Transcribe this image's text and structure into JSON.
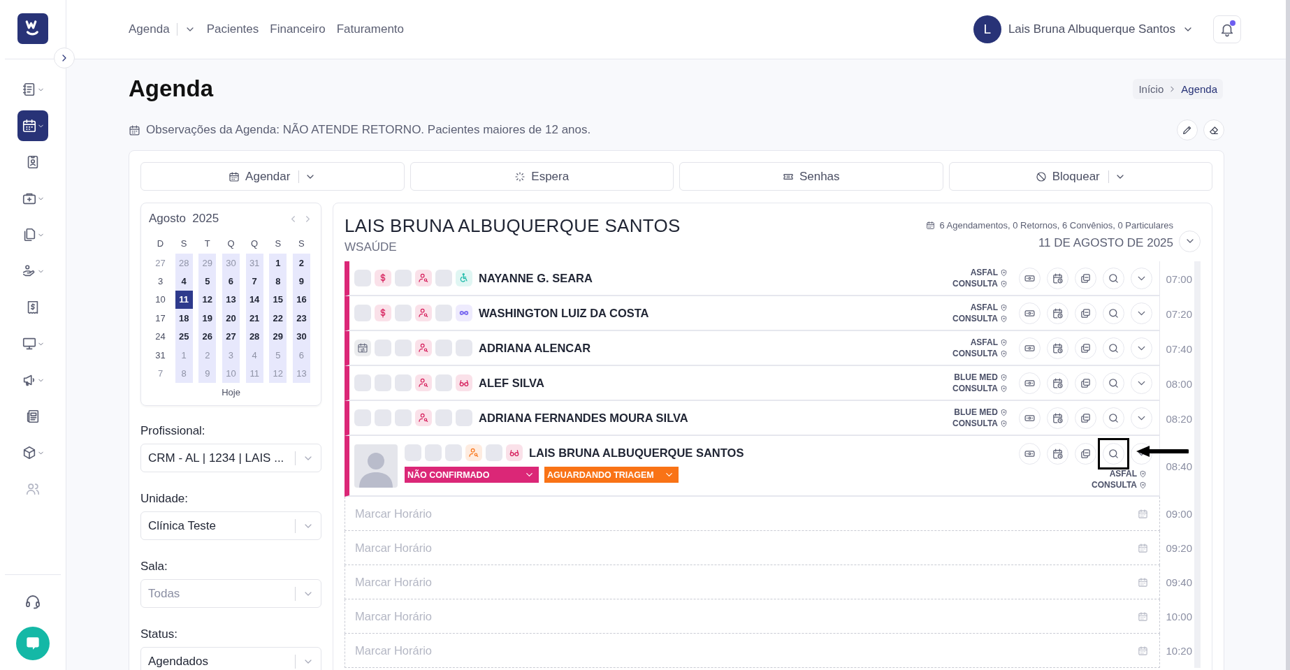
{
  "sidebar": {
    "items": [
      {
        "kind": "notebook",
        "has_menu": true,
        "selected": false,
        "disabled": false
      },
      {
        "kind": "calendar",
        "has_menu": true,
        "selected": true,
        "disabled": false
      },
      {
        "kind": "id-card",
        "has_menu": false,
        "selected": false,
        "disabled": false
      },
      {
        "kind": "medkit",
        "has_menu": true,
        "selected": false,
        "disabled": false
      },
      {
        "kind": "files",
        "has_menu": true,
        "selected": false,
        "disabled": false
      },
      {
        "kind": "hand",
        "has_menu": true,
        "selected": false,
        "disabled": false
      },
      {
        "kind": "receipt",
        "has_menu": false,
        "selected": false,
        "disabled": false
      },
      {
        "kind": "monitor",
        "has_menu": true,
        "selected": false,
        "disabled": false
      },
      {
        "kind": "megaphone",
        "has_menu": true,
        "selected": false,
        "disabled": false
      },
      {
        "kind": "news",
        "has_menu": false,
        "selected": false,
        "disabled": false
      },
      {
        "kind": "box",
        "has_menu": true,
        "selected": false,
        "disabled": false
      },
      {
        "kind": "users",
        "has_menu": false,
        "selected": false,
        "disabled": true
      }
    ]
  },
  "top_nav": {
    "links": [
      {
        "label": "Agenda",
        "has_menu": true
      },
      {
        "label": "Pacientes",
        "has_menu": false
      },
      {
        "label": "Financeiro",
        "has_menu": false
      },
      {
        "label": "Faturamento",
        "has_menu": false
      }
    ]
  },
  "user": {
    "initial": "L",
    "name": "Lais Bruna Albuquerque Santos"
  },
  "notifications": {
    "unread": true
  },
  "page": {
    "title": "Agenda",
    "breadcrumb": [
      {
        "label": "Início",
        "current": false
      },
      {
        "label": "Agenda",
        "current": true
      }
    ],
    "notes": "Observações da Agenda: NÃO ATENDE RETORNO. Pacientes maiores de 12 anos."
  },
  "actions": [
    {
      "label": "Agendar",
      "kind": "calendar",
      "has_menu": true
    },
    {
      "label": "Espera",
      "kind": "loader",
      "has_menu": false
    },
    {
      "label": "Senhas",
      "kind": "ticket",
      "has_menu": false
    },
    {
      "label": "Bloquear",
      "kind": "ban",
      "has_menu": true
    }
  ],
  "calendar": {
    "month": "Agosto",
    "year": "2025",
    "today_label": "Hoje",
    "weekdays": [
      {
        "label": "D",
        "open": false
      },
      {
        "label": "S",
        "open": true
      },
      {
        "label": "T",
        "open": true
      },
      {
        "label": "Q",
        "open": true
      },
      {
        "label": "Q",
        "open": true
      },
      {
        "label": "S",
        "open": true
      },
      {
        "label": "S",
        "open": true
      }
    ],
    "days": [
      {
        "label": "27",
        "muted": true,
        "selected": false
      },
      {
        "label": "28",
        "muted": true,
        "selected": false
      },
      {
        "label": "29",
        "muted": true,
        "selected": false
      },
      {
        "label": "30",
        "muted": true,
        "selected": false
      },
      {
        "label": "31",
        "muted": true,
        "selected": false
      },
      {
        "label": "1",
        "muted": false,
        "selected": false
      },
      {
        "label": "2",
        "muted": false,
        "selected": false
      },
      {
        "label": "3",
        "muted": false,
        "selected": false
      },
      {
        "label": "4",
        "muted": false,
        "selected": false
      },
      {
        "label": "5",
        "muted": false,
        "selected": false
      },
      {
        "label": "6",
        "muted": false,
        "selected": false
      },
      {
        "label": "7",
        "muted": false,
        "selected": false
      },
      {
        "label": "8",
        "muted": false,
        "selected": false
      },
      {
        "label": "9",
        "muted": false,
        "selected": false
      },
      {
        "label": "10",
        "muted": false,
        "selected": false
      },
      {
        "label": "11",
        "muted": false,
        "selected": true
      },
      {
        "label": "12",
        "muted": false,
        "selected": false
      },
      {
        "label": "13",
        "muted": false,
        "selected": false
      },
      {
        "label": "14",
        "muted": false,
        "selected": false
      },
      {
        "label": "15",
        "muted": false,
        "selected": false
      },
      {
        "label": "16",
        "muted": false,
        "selected": false
      },
      {
        "label": "17",
        "muted": false,
        "selected": false
      },
      {
        "label": "18",
        "muted": false,
        "selected": false
      },
      {
        "label": "19",
        "muted": false,
        "selected": false
      },
      {
        "label": "20",
        "muted": false,
        "selected": false
      },
      {
        "label": "21",
        "muted": false,
        "selected": false
      },
      {
        "label": "22",
        "muted": false,
        "selected": false
      },
      {
        "label": "23",
        "muted": false,
        "selected": false
      },
      {
        "label": "24",
        "muted": false,
        "selected": false
      },
      {
        "label": "25",
        "muted": false,
        "selected": false
      },
      {
        "label": "26",
        "muted": false,
        "selected": false
      },
      {
        "label": "27",
        "muted": false,
        "selected": false
      },
      {
        "label": "28",
        "muted": false,
        "selected": false
      },
      {
        "label": "29",
        "muted": false,
        "selected": false
      },
      {
        "label": "30",
        "muted": false,
        "selected": false
      },
      {
        "label": "31",
        "muted": false,
        "selected": false
      },
      {
        "label": "1",
        "muted": true,
        "selected": false
      },
      {
        "label": "2",
        "muted": true,
        "selected": false
      },
      {
        "label": "3",
        "muted": true,
        "selected": false
      },
      {
        "label": "4",
        "muted": true,
        "selected": false
      },
      {
        "label": "5",
        "muted": true,
        "selected": false
      },
      {
        "label": "6",
        "muted": true,
        "selected": false
      },
      {
        "label": "7",
        "muted": true,
        "selected": false
      },
      {
        "label": "8",
        "muted": true,
        "selected": false
      },
      {
        "label": "9",
        "muted": true,
        "selected": false
      },
      {
        "label": "10",
        "muted": true,
        "selected": false
      },
      {
        "label": "11",
        "muted": true,
        "selected": false
      },
      {
        "label": "12",
        "muted": true,
        "selected": false
      },
      {
        "label": "13",
        "muted": true,
        "selected": false
      }
    ]
  },
  "filters": [
    {
      "label": "Profissional:",
      "value": "CRM - AL | 1234 | LAIS ..."
    },
    {
      "label": "Unidade:",
      "value": "Clínica Teste"
    },
    {
      "label": "Sala:",
      "placeholder": "Todas"
    },
    {
      "label": "Status:",
      "value": "Agendados"
    }
  ],
  "schedule": {
    "professional": "LAIS BRUNA ALBUQUERQUE SANTOS",
    "clinic": "WSAÚDE",
    "summary": "6 Agendamentos, 0 Retornos, 6 Convênios, 0 Particulares",
    "date": "11 DE AGOSTO DE 2025",
    "rows": [
      {
        "kind": "appointment",
        "name": "NAYANNE G. SEARA",
        "insurer": "ASFAL",
        "procedure": "CONSULTA",
        "time": "07:00",
        "expanded": false,
        "search_highlighted": false,
        "badges": [
          {
            "kind": "blank"
          },
          {
            "kind": "dollar",
            "color": "#d61f5c"
          },
          {
            "kind": "blank"
          },
          {
            "kind": "person",
            "color": "#d61f5c"
          },
          {
            "kind": "blank"
          },
          {
            "kind": "accessible",
            "color": "#14b8a6"
          }
        ]
      },
      {
        "kind": "appointment",
        "name": "WASHINGTON LUIZ DA COSTA",
        "insurer": "ASFAL",
        "procedure": "CONSULTA",
        "time": "07:20",
        "expanded": false,
        "search_highlighted": false,
        "badges": [
          {
            "kind": "blank"
          },
          {
            "kind": "dollar",
            "color": "#d61f5c"
          },
          {
            "kind": "blank"
          },
          {
            "kind": "person",
            "color": "#d61f5c"
          },
          {
            "kind": "blank"
          },
          {
            "kind": "infinity",
            "color": "#7c6cf0"
          }
        ]
      },
      {
        "kind": "appointment",
        "name": "ADRIANA ALENCAR",
        "insurer": "ASFAL",
        "procedure": "CONSULTA",
        "time": "07:40",
        "expanded": false,
        "search_highlighted": false,
        "badges": [
          {
            "kind": "calendar-sync",
            "color": "#6b6f82"
          },
          {
            "kind": "blank"
          },
          {
            "kind": "blank"
          },
          {
            "kind": "person",
            "color": "#d61f5c"
          },
          {
            "kind": "blank"
          },
          {
            "kind": "blank"
          }
        ]
      },
      {
        "kind": "appointment",
        "name": "ALEF SILVA",
        "insurer": "BLUE MED",
        "procedure": "CONSULTA",
        "time": "08:00",
        "expanded": false,
        "search_highlighted": false,
        "badges": [
          {
            "kind": "blank"
          },
          {
            "kind": "blank"
          },
          {
            "kind": "blank"
          },
          {
            "kind": "person",
            "color": "#d61f5c"
          },
          {
            "kind": "blank"
          },
          {
            "kind": "glasses",
            "color": "#d61f5c"
          }
        ]
      },
      {
        "kind": "appointment",
        "name": "ADRIANA FERNANDES MOURA SILVA",
        "insurer": "BLUE MED",
        "procedure": "CONSULTA",
        "time": "08:20",
        "expanded": false,
        "search_highlighted": false,
        "badges": [
          {
            "kind": "blank"
          },
          {
            "kind": "blank"
          },
          {
            "kind": "blank"
          },
          {
            "kind": "person",
            "color": "#d61f5c"
          },
          {
            "kind": "blank"
          },
          {
            "kind": "blank"
          }
        ]
      },
      {
        "kind": "appointment",
        "name": "LAIS BRUNA ALBUQUERQUE SANTOS",
        "insurer": "ASFAL",
        "procedure": "CONSULTA",
        "time": "08:40",
        "expanded": true,
        "search_highlighted": true,
        "badges": [
          {
            "kind": "blank"
          },
          {
            "kind": "blank"
          },
          {
            "kind": "blank"
          },
          {
            "kind": "person",
            "color": "#f97316"
          },
          {
            "kind": "blank"
          },
          {
            "kind": "glasses",
            "color": "#d61f5c"
          }
        ],
        "tags": [
          {
            "label": "NÃO CONFIRMADO",
            "color": "#db2777"
          },
          {
            "label": "AGUARDANDO TRIAGEM",
            "color": "#f97316"
          }
        ]
      },
      {
        "kind": "free",
        "placeholder": "Marcar Horário",
        "time": "09:00"
      },
      {
        "kind": "free",
        "placeholder": "Marcar Horário",
        "time": "09:20"
      },
      {
        "kind": "free",
        "placeholder": "Marcar Horário",
        "time": "09:40"
      },
      {
        "kind": "free",
        "placeholder": "Marcar Horário",
        "time": "10:00"
      },
      {
        "kind": "free",
        "placeholder": "Marcar Horário",
        "time": "10:20"
      }
    ]
  }
}
